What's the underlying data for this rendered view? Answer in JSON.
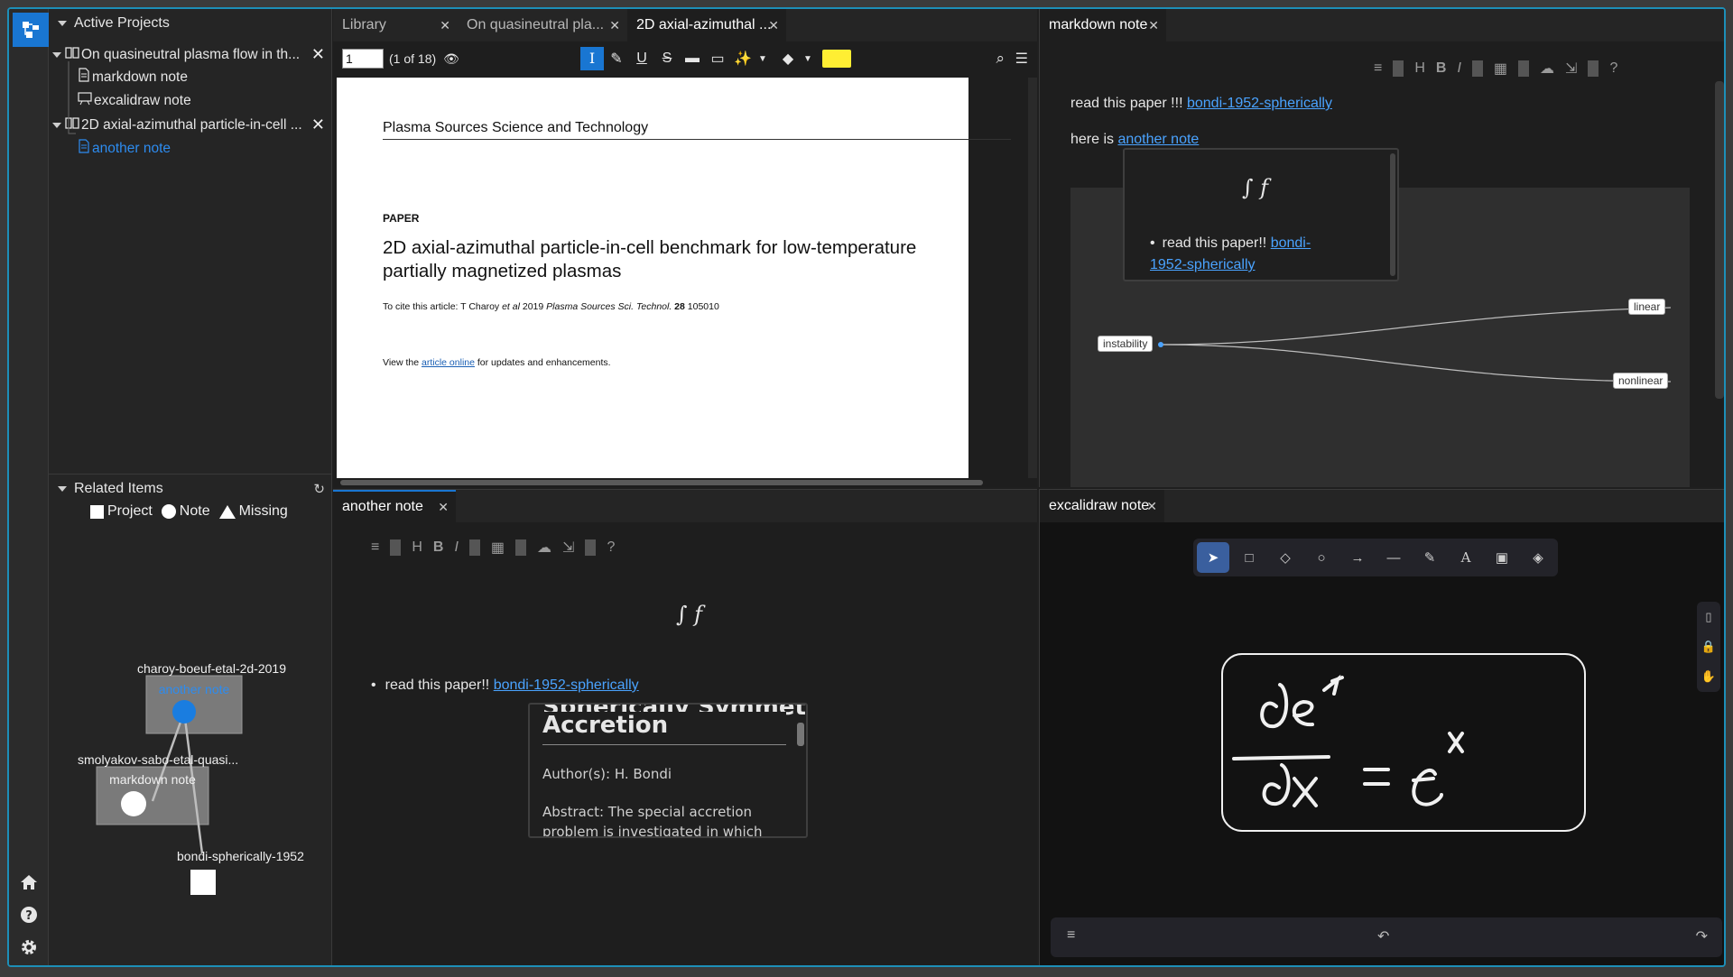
{
  "sidebar": {
    "active_projects_label": "Active Projects",
    "projects": [
      {
        "title": "On quasineutral plasma flow in th...",
        "children": [
          "markdown note",
          "excalidraw note"
        ]
      },
      {
        "title": "2D axial-azimuthal particle-in-cell ...",
        "children": [
          "another note"
        ]
      }
    ],
    "related_items_label": "Related Items",
    "legend": {
      "project": "Project",
      "note": "Note",
      "missing": "Missing"
    },
    "graph": {
      "node_charoy": "charoy-boeuf-etal-2d-2019",
      "node_another": "another note",
      "node_smolyakov": "smolyakov-sabo-etal-quasi...",
      "node_markdown": "markdown note",
      "node_bondi": "bondi-spherically-1952"
    }
  },
  "pdf_pane": {
    "tabs": [
      "Library",
      "On quasineutral pla...",
      "2D axial-azimuthal ..."
    ],
    "page_input": "1",
    "page_count": "(1 of 18)",
    "highlight_color": "#ffee33",
    "journal": "Plasma Sources Science and Technology",
    "kind": "PAPER",
    "title": "2D axial-azimuthal particle-in-cell benchmark for low-temperature partially magnetized plasmas",
    "cite_prefix": "To cite this article: T Charoy ",
    "cite_etal": "et al",
    "cite_year": " 2019 ",
    "cite_journal": "Plasma Sources Sci. Technol.",
    "cite_vol": " 28",
    "cite_page": " 105010",
    "view_prefix": "View the ",
    "view_link": "article online",
    "view_suffix": " for updates and enhancements."
  },
  "markdown_pane": {
    "tab": "markdown note",
    "line1_text": "read this paper !!! ",
    "line1_link": "bondi-1952-spherically",
    "line2_text": "here is ",
    "line2_link": "another note",
    "hover_integral": "∫ f",
    "hover_bullet_text": "read this paper!! ",
    "hover_bullet_link_1": "bondi-",
    "hover_bullet_link_2": "1952-spherically",
    "mindmap": {
      "root": "instability",
      "child1": "linear",
      "child2": "nonlinear"
    }
  },
  "another_pane": {
    "tab": "another note",
    "integral": "∫ f",
    "bullet_text": "read this paper!! ",
    "bullet_link": "bondi-1952-spherically",
    "hover_title_cut": "Spherically Symmetrical",
    "hover_title": "Accretion",
    "hover_author": "Author(s): H. Bondi",
    "hover_abstract": "Abstract: The special accretion problem is investigated in which"
  },
  "excalidraw_pane": {
    "tab": "excalidraw note"
  },
  "colors": {
    "accent": "#1976d2",
    "link": "#4aa3ff",
    "frame": "#1d8fb8"
  }
}
